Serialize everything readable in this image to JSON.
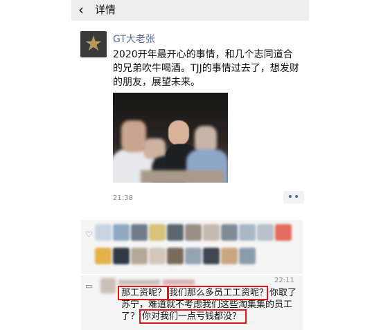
{
  "nav": {
    "back_icon": "chevron-left-icon",
    "title": "详情"
  },
  "post": {
    "author": "GT大老张",
    "text": "2020开年最开心的事情，和几个志同道合的兄弟吹牛喝酒。TJJ的事情过去了，想发财的朋友，展望未来。",
    "time": "21:38",
    "more_label": "••"
  },
  "likes": {
    "icon": "heart-icon"
  },
  "comment": {
    "icon": "comment-icon",
    "time": "22:11",
    "q1": "那工资呢？",
    "q2": "我们那么多员工工资呢？",
    "line1_tail": "你取了",
    "line2": "苏宁，难道就不考虑我们这些淘集集的员工",
    "line3_prefix": "了？",
    "q3": "你对我们一点亏钱都没？"
  },
  "colors": {
    "link": "#576b95",
    "highlight_box": "#e0161d",
    "nav_bg": "#ededed",
    "panel_bg": "#f5f5f5"
  }
}
